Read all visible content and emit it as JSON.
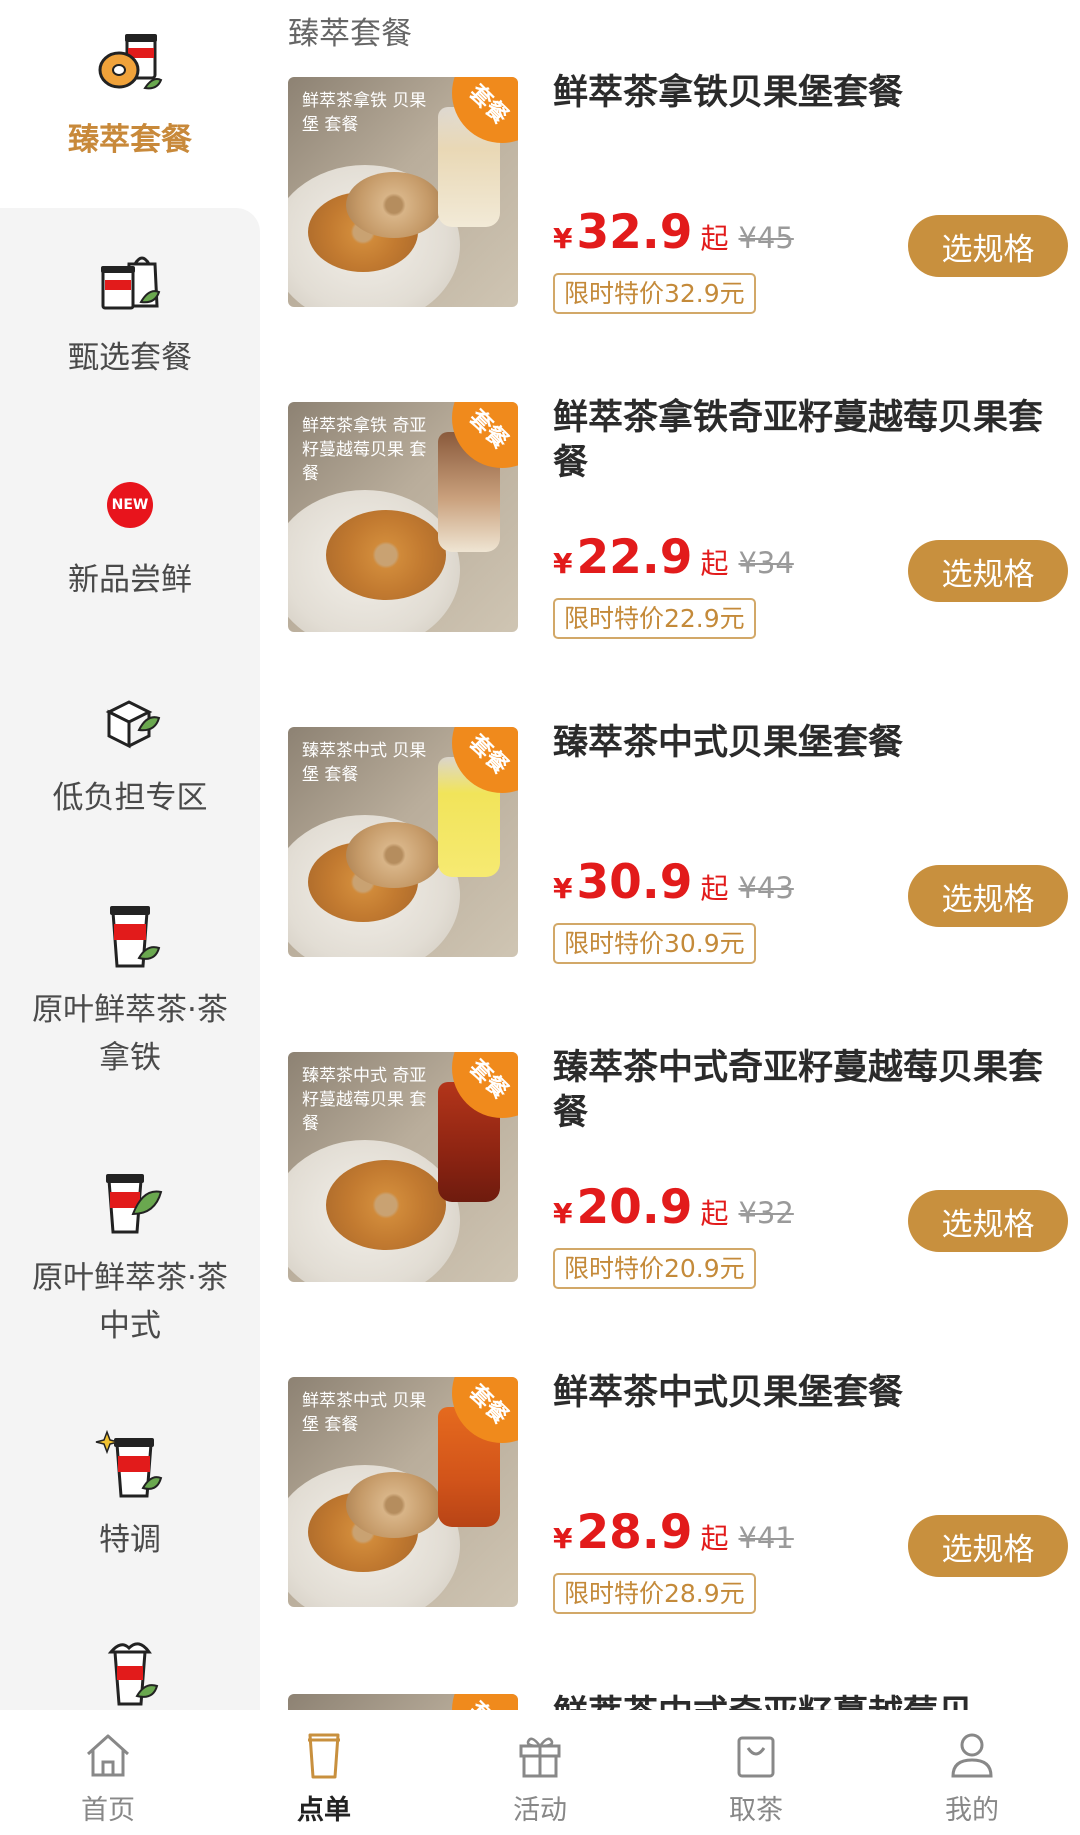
{
  "section_title": "臻萃套餐",
  "categories": [
    {
      "label": "臻萃套餐",
      "icon": "bagel-cup-icon"
    },
    {
      "label": "甄选套餐",
      "icon": "cup-bag-icon"
    },
    {
      "label": "新品尝鲜",
      "icon": "new-badge-icon",
      "badge": "NEW"
    },
    {
      "label": "低负担专区",
      "icon": "box-leaf-icon"
    },
    {
      "label": "原叶鲜萃茶·茶拿铁",
      "icon": "tea-cup-icon"
    },
    {
      "label": "原叶鲜萃茶·茶中式",
      "icon": "tea-cup-leaf-icon"
    },
    {
      "label": "特调",
      "icon": "sparkle-cup-icon"
    },
    {
      "label": "",
      "icon": "shaker-cup-icon"
    }
  ],
  "products": [
    {
      "name": "鲜萃茶拿铁贝果堡套餐",
      "caption": "鲜萃茶拿铁 贝果堡 套餐",
      "badge": "套餐",
      "yen": "¥",
      "price": "32.9",
      "qi": "起",
      "orig": "¥45",
      "promo": "限时特价32.9元",
      "cup": "cream"
    },
    {
      "name": "鲜萃茶拿铁奇亚籽蔓越莓贝果套餐",
      "caption": "鲜萃茶拿铁 奇亚籽蔓越莓贝果 套餐",
      "badge": "套餐",
      "yen": "¥",
      "price": "22.9",
      "qi": "起",
      "orig": "¥34",
      "promo": "限时特价22.9元",
      "cup": "brown"
    },
    {
      "name": "臻萃茶中式贝果堡套餐",
      "caption": "臻萃茶中式 贝果堡 套餐",
      "badge": "套餐",
      "yen": "¥",
      "price": "30.9",
      "qi": "起",
      "orig": "¥43",
      "promo": "限时特价30.9元",
      "cup": "yellow"
    },
    {
      "name": "臻萃茶中式奇亚籽蔓越莓贝果套餐",
      "caption": "臻萃茶中式 奇亚籽蔓越莓贝果 套餐",
      "badge": "套餐",
      "yen": "¥",
      "price": "20.9",
      "qi": "起",
      "orig": "¥32",
      "promo": "限时特价20.9元",
      "cup": "red"
    },
    {
      "name": "鲜萃茶中式贝果堡套餐",
      "caption": "鲜萃茶中式 贝果堡 套餐",
      "badge": "套餐",
      "yen": "¥",
      "price": "28.9",
      "qi": "起",
      "orig": "¥41",
      "promo": "限时特价28.9元",
      "cup": "orange"
    },
    {
      "name": "鲜萃茶中式奇亚籽蔓越莓贝",
      "caption": "",
      "badge": "套餐",
      "yen": "",
      "price": "",
      "qi": "",
      "orig": "",
      "promo": "",
      "cup": "red"
    }
  ],
  "spec_button_label": "选规格",
  "bottom_nav": [
    {
      "label": "首页",
      "icon": "home-icon"
    },
    {
      "label": "点单",
      "icon": "cup-icon"
    },
    {
      "label": "活动",
      "icon": "gift-icon"
    },
    {
      "label": "取茶",
      "icon": "bag-icon"
    },
    {
      "label": "我的",
      "icon": "user-icon"
    }
  ],
  "colors": {
    "accent": "#c8903e",
    "price": "#e21b1b",
    "active_category": "#c8893a",
    "badge": "#f08a1c"
  }
}
